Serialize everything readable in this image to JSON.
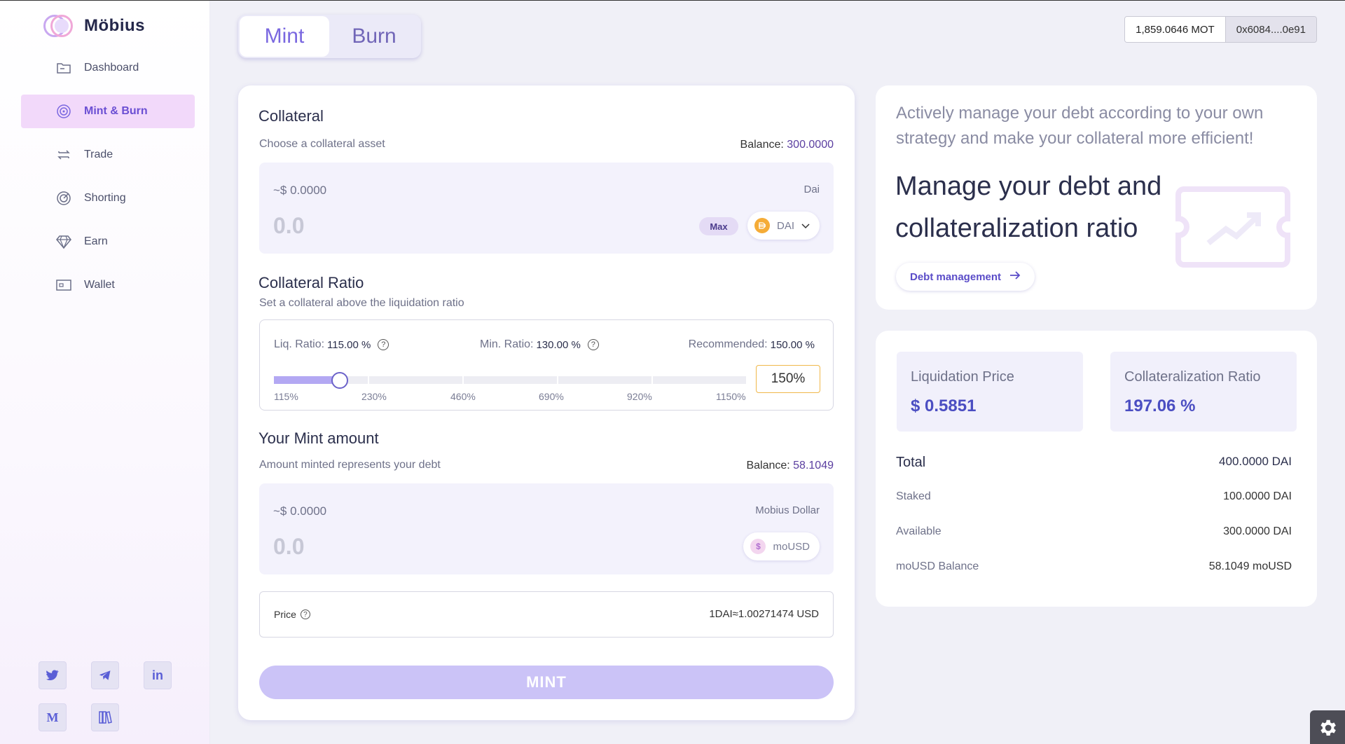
{
  "brand": {
    "name": "Möbius"
  },
  "nav": {
    "items": [
      {
        "label": "Dashboard",
        "icon": "folder-icon"
      },
      {
        "label": "Mint & Burn",
        "icon": "spiral-icon",
        "active": true
      },
      {
        "label": "Trade",
        "icon": "swap-icon"
      },
      {
        "label": "Shorting",
        "icon": "target-icon"
      },
      {
        "label": "Earn",
        "icon": "diamond-icon"
      },
      {
        "label": "Wallet",
        "icon": "wallet-icon"
      }
    ]
  },
  "socials": [
    "twitter-icon",
    "telegram-icon",
    "linkedin-icon",
    "medium-icon",
    "docs-icon"
  ],
  "socials_text": {
    "medium": "M",
    "linkedin": "in"
  },
  "tabs": {
    "mint": "Mint",
    "burn": "Burn",
    "active": "Mint"
  },
  "wallet": {
    "balance": "1,859.0646 MOT",
    "address": "0x6084....0e91"
  },
  "collateral": {
    "title": "Collateral",
    "subtitle": "Choose a collateral asset",
    "balance_label": "Balance:",
    "balance_value": "300.0000",
    "usd": "~$ 0.0000",
    "asset_name": "Dai",
    "amount_placeholder": "0.0",
    "max_label": "Max",
    "token": "DAI"
  },
  "ratio": {
    "title": "Collateral Ratio",
    "subtitle": "Set a collateral above the liquidation ratio",
    "liq_label": "Liq. Ratio:",
    "liq_value": "115.00 %",
    "min_label": "Min. Ratio:",
    "min_value": "130.00 %",
    "rec_label": "Recommended:",
    "rec_value": "150.00 %",
    "ticks": [
      "115%",
      "230%",
      "460%",
      "690%",
      "920%",
      "1150%"
    ],
    "slider_value_fraction": 0.14,
    "current": "150%"
  },
  "mint_amount": {
    "title": "Your Mint amount",
    "subtitle": "Amount minted represents your debt",
    "balance_label": "Balance:",
    "balance_value": "58.1049",
    "usd": "~$ 0.0000",
    "asset_name": "Mobius Dollar",
    "amount_placeholder": "0.0",
    "token": "moUSD"
  },
  "price": {
    "label": "Price",
    "value": "1DAI≈1.00271474 USD"
  },
  "mint_button": "MINT",
  "info": {
    "intro": "Actively manage your debt according to your own strategy and make your collateral more efficient!",
    "headline": "Manage your debt and collateralization ratio",
    "button": "Debt management"
  },
  "stats": {
    "liq_price_label": "Liquidation Price",
    "liq_price_value": "$ 0.5851",
    "coll_ratio_label": "Collateralization Ratio",
    "coll_ratio_value": "197.06 %",
    "rows": [
      {
        "label": "Total",
        "value": "400.0000 DAI"
      },
      {
        "label": "Staked",
        "value": "100.0000 DAI"
      },
      {
        "label": "Available",
        "value": "300.0000 DAI"
      },
      {
        "label": "moUSD Balance",
        "value": "58.1049 moUSD"
      }
    ]
  },
  "colors": {
    "accent": "#7a68e0",
    "active_nav_bg": "#f2d9fa",
    "mint_button": "#cbc3f7",
    "ratio_border": "#f0b84a"
  }
}
